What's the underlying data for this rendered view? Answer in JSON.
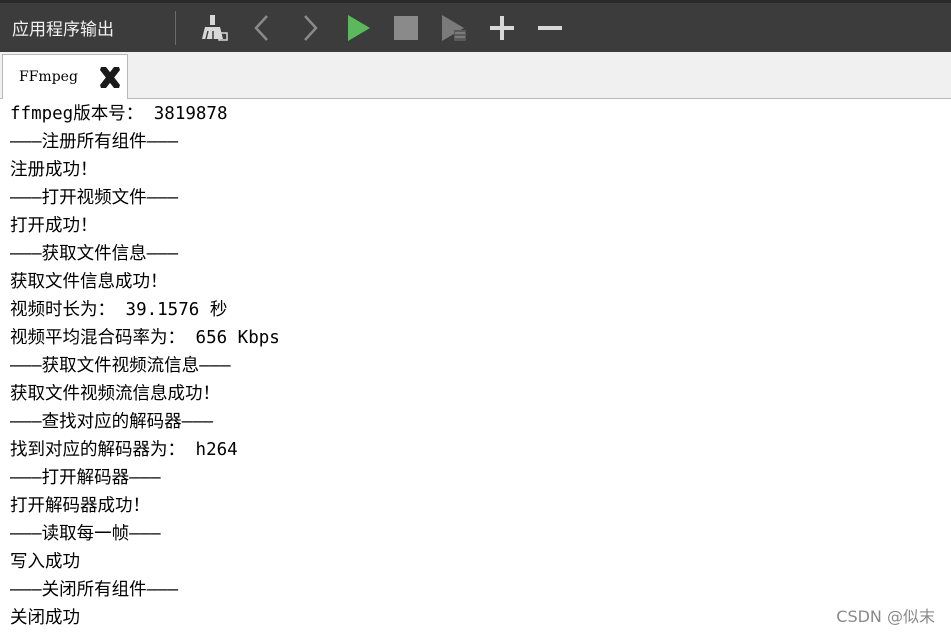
{
  "toolbar": {
    "title": "应用程序输出",
    "buttons": [
      {
        "name": "clean-button",
        "icon": "broom-icon"
      },
      {
        "name": "previous-button",
        "icon": "chevron-left-icon"
      },
      {
        "name": "next-button",
        "icon": "chevron-right-icon"
      },
      {
        "name": "run-button",
        "icon": "play-icon"
      },
      {
        "name": "stop-button",
        "icon": "stop-icon"
      },
      {
        "name": "attach-debugger-button",
        "icon": "debug-play-icon"
      },
      {
        "name": "zoom-in-button",
        "icon": "plus-icon"
      },
      {
        "name": "zoom-out-button",
        "icon": "minus-icon"
      }
    ],
    "colors": {
      "background": "#3c3c3c",
      "run_green": "#5cb85c",
      "icon_gray": "#8a8a8a",
      "icon_light": "#d8d8d8"
    }
  },
  "tab": {
    "label": "FFmpeg",
    "close_icon": "close-icon"
  },
  "output": {
    "lines": [
      "ffmpeg版本号： 3819878",
      "———注册所有组件———",
      "注册成功！",
      "———打开视频文件———",
      "打开成功！",
      "———获取文件信息———",
      "获取文件信息成功！",
      "视频时长为： 39.1576 秒",
      "视频平均混合码率为： 656 Kbps",
      "———获取文件视频流信息———",
      "获取文件视频流信息成功！",
      "———查找对应的解码器———",
      "找到对应的解码器为： h264",
      "———打开解码器———",
      "打开解码器成功！",
      "———读取每一帧———",
      "写入成功",
      "———关闭所有组件———",
      "关闭成功"
    ]
  },
  "watermark": "CSDN @似末"
}
